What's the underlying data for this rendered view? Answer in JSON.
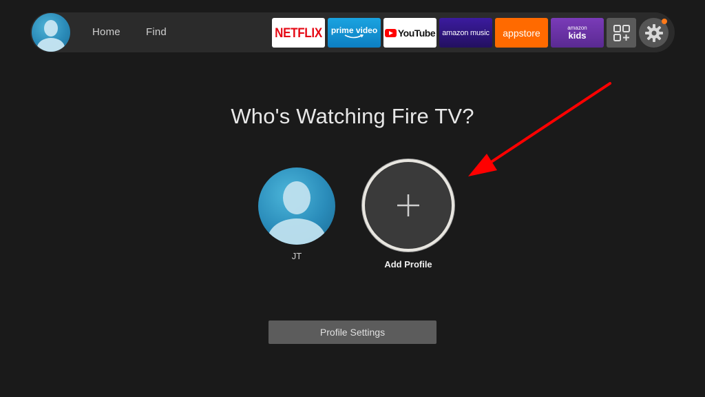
{
  "topbar": {
    "nav": {
      "home_label": "Home",
      "find_label": "Find"
    },
    "apps": {
      "netflix": "NETFLIX",
      "prime_video": "prime video",
      "youtube": "YouTube",
      "amazon_music": "amazon music",
      "appstore": "appstore",
      "amazon_kids_top": "amazon",
      "amazon_kids_bottom": "kids"
    },
    "icons": {
      "avatar": "user-avatar-icon",
      "apps_grid": "apps-grid-icon",
      "settings": "gear-icon"
    },
    "notification_color": "#ff7a1a"
  },
  "main": {
    "title": "Who's Watching Fire TV?",
    "profiles": [
      {
        "name": "JT"
      },
      {
        "name": "Add Profile"
      }
    ],
    "profile_settings_label": "Profile Settings"
  },
  "colors": {
    "background": "#1a1a1a",
    "topbar": "#2b2b2b",
    "annotation_arrow": "#ff0000",
    "avatar_blue": "#2a8cba"
  }
}
